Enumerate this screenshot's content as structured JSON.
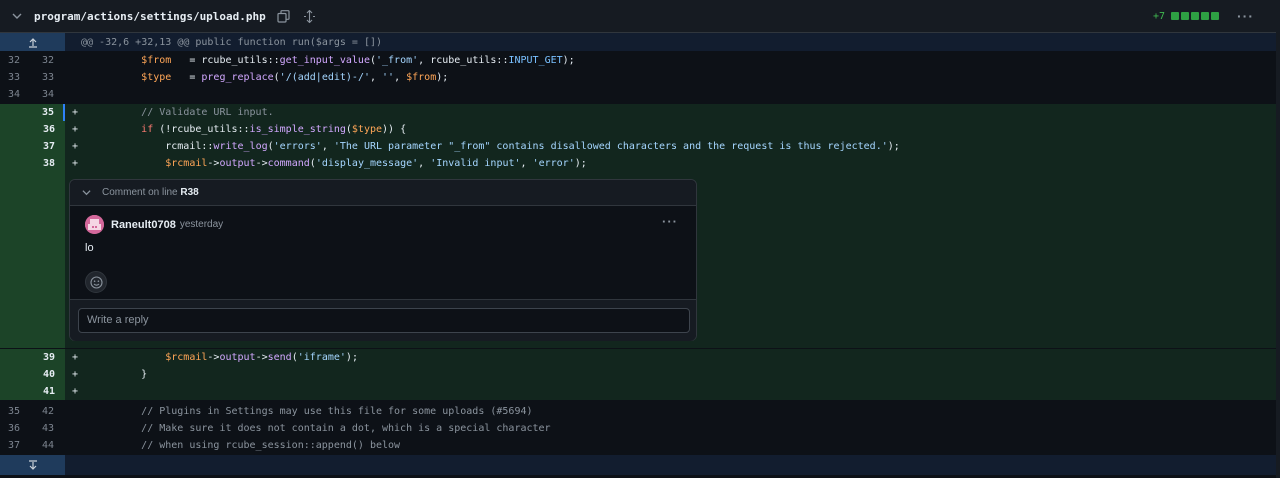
{
  "file": {
    "path": "program/actions/settings/upload.php",
    "additions": "+7",
    "addition_blocks": 5
  },
  "hunk_header": "@@ -32,6 +32,13 @@ public function run($args = [])",
  "lines": [
    {
      "old": "32",
      "new": "32",
      "mark": "",
      "type": "ctx"
    },
    {
      "old": "33",
      "new": "33",
      "mark": "",
      "type": "ctx"
    },
    {
      "old": "34",
      "new": "34",
      "mark": "",
      "type": "ctx"
    },
    {
      "old": "",
      "new": "35",
      "mark": "+",
      "type": "add"
    },
    {
      "old": "",
      "new": "36",
      "mark": "+",
      "type": "add"
    },
    {
      "old": "",
      "new": "37",
      "mark": "+",
      "type": "add"
    },
    {
      "old": "",
      "new": "38",
      "mark": "+",
      "type": "add"
    },
    {
      "old": "",
      "new": "39",
      "mark": "+",
      "type": "add"
    },
    {
      "old": "",
      "new": "40",
      "mark": "+",
      "type": "add"
    },
    {
      "old": "",
      "new": "41",
      "mark": "+",
      "type": "add"
    },
    {
      "old": "35",
      "new": "42",
      "mark": "",
      "type": "ctx"
    },
    {
      "old": "36",
      "new": "43",
      "mark": "",
      "type": "ctx"
    },
    {
      "old": "37",
      "new": "44",
      "mark": "",
      "type": "ctx"
    }
  ],
  "code": {
    "l32": {
      "indent": "        ",
      "v": "$from",
      "p1": "   = rcube_utils::",
      "f": "get_input_value",
      "p2": "(",
      "s": "'_from'",
      "p3": ", rcube_utils::",
      "c": "INPUT_GET",
      "p4": ");"
    },
    "l33": {
      "indent": "        ",
      "v": "$type",
      "p1": "   = ",
      "f": "preg_replace",
      "p2": "(",
      "s1": "'/(add|edit)-/'",
      "p3": ", ",
      "s2": "''",
      "p4": ", ",
      "v2": "$from",
      "p5": ");"
    },
    "l35": {
      "indent": "        ",
      "c": "// Validate URL input."
    },
    "l36": {
      "indent": "        ",
      "k": "if",
      "p1": " (!rcube_utils::",
      "f": "is_simple_string",
      "p2": "(",
      "v": "$type",
      "p3": ")) {"
    },
    "l37": {
      "indent": "            ",
      "p0": "rcmail::",
      "f": "write_log",
      "p1": "(",
      "s1": "'errors'",
      "p2": ", ",
      "s2": "'The URL parameter \"_from\" contains disallowed characters and the request is thus rejected.'",
      "p3": ");"
    },
    "l38": {
      "indent": "            ",
      "v": "$rcmail",
      "p1": "->",
      "f1": "output",
      "p2": "->",
      "f2": "command",
      "p3": "(",
      "s1": "'display_message'",
      "p4": ", ",
      "s2": "'Invalid input'",
      "p5": ", ",
      "s3": "'error'",
      "p6": ");"
    },
    "l39": {
      "indent": "            ",
      "v": "$rcmail",
      "p1": "->",
      "f1": "output",
      "p2": "->",
      "f2": "send",
      "p3": "(",
      "s": "'iframe'",
      "p4": ");"
    },
    "l40": {
      "indent": "        ",
      "p": "}"
    },
    "l42": {
      "indent": "        ",
      "c": "// Plugins in Settings may use this file for some uploads (#5694)"
    },
    "l43": {
      "indent": "        ",
      "c": "// Make sure it does not contain a dot, which is a special character"
    },
    "l44": {
      "indent": "        ",
      "c": "// when using rcube_session::append() below"
    }
  },
  "comment": {
    "heading": "Comment on line",
    "line_ref": "R38",
    "author": "Raneult0708",
    "time": "yesterday",
    "body": "lo",
    "reply_placeholder": "Write a reply"
  },
  "colors": {
    "addition": "#2ea043",
    "add_bg": "#12261e",
    "add_gutter": "#1c4428",
    "hunk_bg": "#121d2f",
    "avatar": "#d4689b"
  },
  "icons": {
    "collapse": "chevron-down-icon",
    "copy": "copy-icon",
    "expand_all": "unfold-icon",
    "expand_up": "expand-up-icon",
    "expand_down": "expand-down-icon",
    "menu": "kebab-icon",
    "reaction": "smiley-icon"
  }
}
